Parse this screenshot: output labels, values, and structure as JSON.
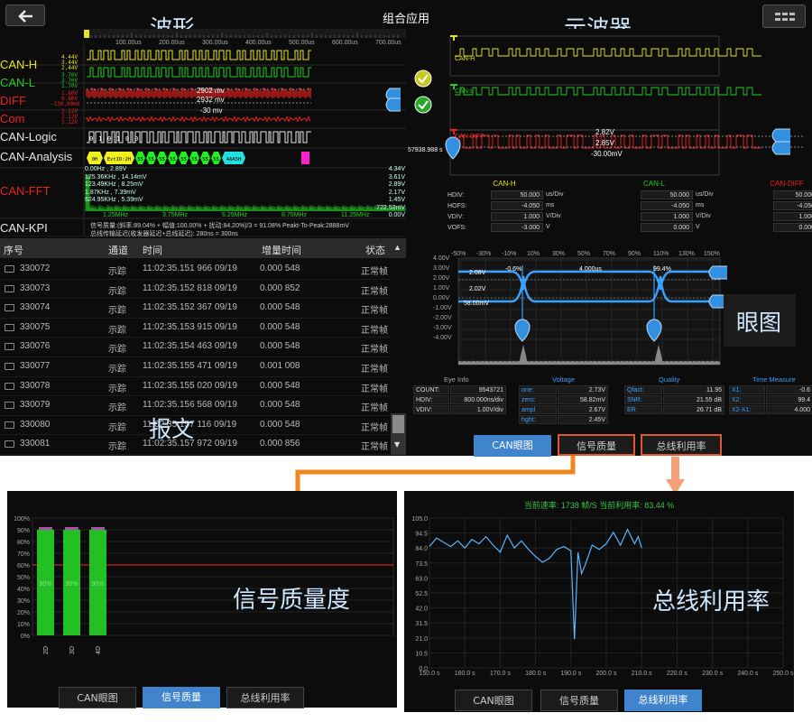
{
  "header": {
    "title": "组合应用"
  },
  "labels": {
    "waveform": "波形",
    "oscilloscope": "示波器",
    "eye": "眼图",
    "message": "报文",
    "signal_quality": "信号质量度",
    "bus_util": "总线利用率"
  },
  "wave": {
    "time_ticks": [
      "100.00us",
      "200.00us",
      "300.00us",
      "400.00us",
      "500.00us",
      "600.00us",
      "700.00us"
    ],
    "channels": [
      {
        "name": "CAN-H",
        "color": "#e5e51e",
        "mini": [
          "4.44V",
          "3.44V",
          "2.44V"
        ]
      },
      {
        "name": "CAN-L",
        "color": "#22cc22",
        "mini": [
          "3.70V",
          "2.70V",
          "1.70V"
        ]
      },
      {
        "name": "DIFF",
        "color": "#ee2020",
        "mini": [
          "1.80V",
          "0.80V",
          "-130.00mV"
        ]
      },
      {
        "name": "Com",
        "color": "#ee2020",
        "mini": [
          "3.12V",
          "2.12V",
          "1.12V"
        ]
      },
      {
        "name": "CAN-Logic",
        "color": "#e6e6e6"
      },
      {
        "name": "CAN-Analysis",
        "color": "#e6e6e6"
      },
      {
        "name": "CAN-FFT",
        "color": "#ee2020"
      },
      {
        "name": "CAN-KPI",
        "color": "#e6e6e6"
      }
    ],
    "diff_cursor_labels": [
      "2902 mv",
      "2932 mv",
      "-30 mv"
    ],
    "logic_digits": [
      "0",
      "1",
      "0",
      "1",
      "0",
      "0"
    ],
    "analysis_frames": [
      "0H",
      "ExtID:2H",
      "55",
      "55",
      "55",
      "55",
      "55",
      "55",
      "55",
      "55",
      "4AA5H"
    ],
    "fft_left": [
      "0.00Hz , 2.89V",
      "125.36KHz , 14.14mV",
      "123.49KHz , 8.25mV",
      "1.87KHz , 7.39mV",
      "624.95KHz , 5.39mV"
    ],
    "fft_right": [
      "4.34V",
      "3.61V",
      "2.89V",
      "2.17V",
      "1.45V",
      "722.53mV",
      "0.00V"
    ],
    "fft_freq": [
      "1.25MHz",
      "3.75MHz",
      "6.25MHz",
      "8.75MHz",
      "11.25MHz"
    ],
    "kpi_lines": [
      "信号质量:(斜率:89.04% + 幅值:100.00% + 扰动:84.20%)/3 = 91.08%  Peakt-To-Peak:2888mV",
      "总线传输延迟(收发器延迟+总线延迟): 280ns = 300ns"
    ]
  },
  "table": {
    "headers": [
      "序号",
      "通道",
      "时间",
      "增量时间",
      "状态"
    ],
    "sort_icon": "▲",
    "rows": [
      [
        "330072",
        "示踪",
        "11:02:35.151 966 09/19",
        "0.000 548",
        "正常帧"
      ],
      [
        "330073",
        "示踪",
        "11:02:35.152 818 09/19",
        "0.000 852",
        "正常帧"
      ],
      [
        "330074",
        "示踪",
        "11:02:35.152 367 09/19",
        "0.000 548",
        "正常帧"
      ],
      [
        "330075",
        "示踪",
        "11:02:35.153 915 09/19",
        "0.000 548",
        "正常帧"
      ],
      [
        "330076",
        "示踪",
        "11:02:35.154 463 09/19",
        "0.000 548",
        "正常帧"
      ],
      [
        "330077",
        "示踪",
        "11:02:35.155 471 09/19",
        "0.001 008",
        "正常帧"
      ],
      [
        "330078",
        "示踪",
        "11:02:35.155 020 09/19",
        "0.000 548",
        "正常帧"
      ],
      [
        "330079",
        "示踪",
        "11:02:35.156 568 09/19",
        "0.000 548",
        "正常帧"
      ],
      [
        "330080",
        "示踪",
        "11:02:35.157 116 09/19",
        "0.000 548",
        "正常帧"
      ],
      [
        "330081",
        "示踪",
        "11:02:35.157 972 09/19",
        "0.000 856",
        "正常帧"
      ]
    ]
  },
  "scope": {
    "traces": [
      {
        "name": "CAN-H",
        "color": "#e5e51e"
      },
      {
        "name": "CAN-L",
        "color": "#22cc22"
      },
      {
        "name": "CAN-DIFF",
        "color": "#ee2020"
      }
    ],
    "cursor_labels": [
      "2.82V",
      "2.85V",
      "-30.00mV"
    ],
    "cursor_time": "57938.988 s",
    "param_labels": [
      "HDIV:",
      "HOFS:",
      "VDIV:",
      "VOFS:"
    ],
    "columns": [
      {
        "name": "CAN-H",
        "color": "#e5e51e",
        "values": [
          "50.000",
          "-4.050",
          "1.000",
          "-3.000"
        ],
        "units": [
          "us/Div",
          "ms",
          "V/Div",
          "V"
        ]
      },
      {
        "name": "CAN-L",
        "color": "#22cc22",
        "values": [
          "50.000",
          "-4.050",
          "1.000",
          "0.000"
        ],
        "units": [
          "us/Div",
          "ms",
          "V/Div",
          "V"
        ]
      },
      {
        "name": "CAN-DIFF",
        "color": "#ee2020",
        "values": [
          "50.000",
          "-4.050",
          "1.000",
          "0.000"
        ]
      }
    ]
  },
  "eye": {
    "top_ticks": [
      "-50%",
      "-30%",
      "-10%",
      "10%",
      "30%",
      "50%",
      "70%",
      "90%",
      "110%",
      "130%",
      "150%"
    ],
    "y_ticks": [
      "4.00V",
      "3.00V",
      "2.00V",
      "1.00V",
      "0.00V",
      "-1.00V",
      "-2.00V",
      "-3.00V",
      "-4.00V"
    ],
    "inner": [
      "2.08V",
      "2.02V",
      "58.00mV",
      "-0.6%",
      "4.000us",
      "99.4%"
    ],
    "headers": [
      "Eye Info",
      "Voltage",
      "Quality",
      "Time Measure"
    ],
    "info": [
      [
        "COUNT:",
        "9543721"
      ],
      [
        "HDIV:",
        "800.000ns/div"
      ],
      [
        "VDIV:",
        "1.00V/div"
      ]
    ],
    "voltage": [
      [
        "one:",
        "2.73V"
      ],
      [
        "zero:",
        "58.82mV"
      ],
      [
        "ampl",
        "2.67V"
      ],
      [
        "hght:",
        "2.45V"
      ]
    ],
    "quality": [
      [
        "Qfact:",
        "11.95"
      ],
      [
        "SNR:",
        "21.55 dB"
      ],
      [
        "ER:",
        "26.71 dB"
      ]
    ],
    "time": [
      [
        "X1:",
        "-0.6"
      ],
      [
        "X2:",
        "99.4"
      ],
      [
        "X2-X1:",
        "4.000"
      ]
    ]
  },
  "tabs": [
    "CAN眼图",
    "信号质量",
    "总线利用率"
  ],
  "quality_chart": {
    "type": "bar",
    "categories": [
      "2D",
      "3D",
      "4D"
    ],
    "values": [
      90,
      90,
      90
    ],
    "bar_labels": [
      "90%",
      "90%",
      "90%"
    ],
    "threshold": 60,
    "ylim": [
      0,
      100
    ],
    "y_ticks": [
      "100%",
      "90%",
      "80%",
      "70%",
      "60%",
      "50%",
      "40%",
      "30%",
      "20%",
      "10%",
      "0%"
    ]
  },
  "util_chart": {
    "type": "line",
    "title": "当前速率: 1738 帧/S  当前利用率: 83.44 %",
    "xlim": [
      150,
      250
    ],
    "ylim": [
      0,
      105
    ],
    "x_ticks": [
      "150.0 s",
      "160.0 s",
      "170.0 s",
      "180.0 s",
      "190.0 s",
      "200.0 s",
      "210.0 s",
      "220.0 s",
      "230.0 s",
      "240.0 s",
      "250.0 s"
    ],
    "y_ticks": [
      "105.0",
      "94.5",
      "84.0",
      "73.5",
      "63.0",
      "52.5",
      "42.0",
      "31.5",
      "21.0",
      "10.5",
      "0.0"
    ],
    "x": [
      150,
      152,
      154,
      156,
      158,
      160,
      162,
      164,
      166,
      168,
      170,
      172,
      174,
      176,
      178,
      180,
      182,
      184,
      186,
      188,
      190,
      191,
      192,
      193,
      194,
      196,
      198,
      200,
      202,
      204,
      206,
      208,
      209,
      210
    ],
    "y": [
      85,
      91,
      88,
      85,
      89,
      84,
      90,
      87,
      92,
      86,
      81,
      93,
      84,
      89,
      83,
      78,
      74,
      77,
      83,
      85,
      82,
      20,
      81,
      66,
      72,
      86,
      83,
      87,
      95,
      86,
      97,
      87,
      92,
      84
    ]
  }
}
